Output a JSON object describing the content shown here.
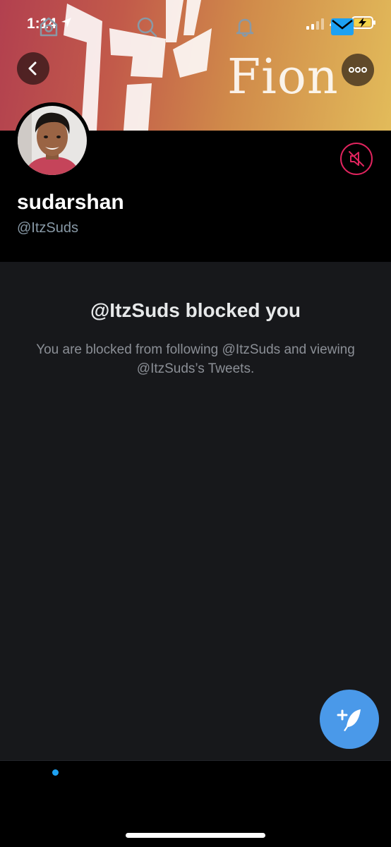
{
  "status_bar": {
    "time": "1:14",
    "network": "4G",
    "icons": [
      "location-arrow-icon",
      "signal-icon",
      "battery-charging-icon"
    ]
  },
  "banner": {
    "word": "Fion"
  },
  "header": {
    "back_icon": "chevron-left-icon",
    "more_icon": "ellipsis-icon"
  },
  "profile": {
    "display_name": "sudarshan",
    "handle": "@ItzSuds",
    "mute_icon": "muted-speaker-icon"
  },
  "blocked": {
    "title": "@ItzSuds blocked you",
    "description": "You are blocked from following @ItzSuds and viewing @ItzSuds’s Tweets."
  },
  "fab": {
    "icon": "compose-tweet-icon"
  },
  "tab_bar": {
    "tabs": [
      {
        "name": "home",
        "icon": "home-icon",
        "has_dot": true
      },
      {
        "name": "search",
        "icon": "search-icon"
      },
      {
        "name": "notifications",
        "icon": "bell-icon"
      },
      {
        "name": "messages",
        "icon": "envelope-icon",
        "active": true
      }
    ]
  },
  "colors": {
    "accent": "#1da1f2",
    "fab": "#4a99e9",
    "mute_red": "#e0245e",
    "muted_text": "#8899a6",
    "panel": "#17181b"
  }
}
